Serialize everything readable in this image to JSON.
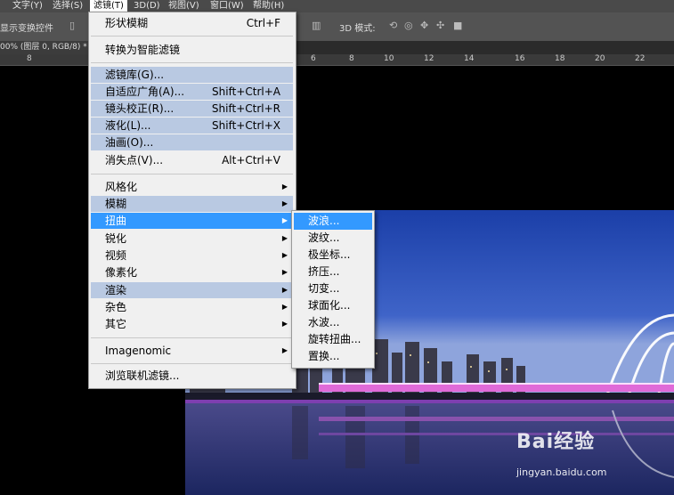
{
  "menubar": {
    "items": [
      {
        "label": "文字(Y)"
      },
      {
        "label": "选择(S)"
      },
      {
        "label": "滤镜(T)"
      },
      {
        "label": "3D(D)"
      },
      {
        "label": "视图(V)"
      },
      {
        "label": "窗口(W)"
      },
      {
        "label": "帮助(H)"
      }
    ]
  },
  "options": {
    "show_transform": "显示变换控件",
    "mode_3d_label": "3D 模式:"
  },
  "document": {
    "tab_title": "00% (图层 0, RGB/8) *"
  },
  "ruler": {
    "left_num": "8",
    "nums": [
      "6",
      "8",
      "10",
      "12",
      "14",
      "16",
      "18",
      "20",
      "22"
    ]
  },
  "filter_menu": {
    "items": [
      {
        "label": "形状模糊",
        "shortcut": "Ctrl+F"
      },
      {
        "label": "转换为智能滤镜",
        "shortcut": ""
      },
      {
        "label": "滤镜库(G)...",
        "shortcut": ""
      },
      {
        "label": "自适应广角(A)...",
        "shortcut": "Shift+Ctrl+A"
      },
      {
        "label": "镜头校正(R)...",
        "shortcut": "Shift+Ctrl+R"
      },
      {
        "label": "液化(L)...",
        "shortcut": "Shift+Ctrl+X"
      },
      {
        "label": "油画(O)...",
        "shortcut": ""
      },
      {
        "label": "消失点(V)...",
        "shortcut": "Alt+Ctrl+V"
      },
      {
        "label": "风格化",
        "shortcut": ""
      },
      {
        "label": "模糊",
        "shortcut": ""
      },
      {
        "label": "扭曲",
        "shortcut": ""
      },
      {
        "label": "锐化",
        "shortcut": ""
      },
      {
        "label": "视频",
        "shortcut": ""
      },
      {
        "label": "像素化",
        "shortcut": ""
      },
      {
        "label": "渲染",
        "shortcut": ""
      },
      {
        "label": "杂色",
        "shortcut": ""
      },
      {
        "label": "其它",
        "shortcut": ""
      },
      {
        "label": "Imagenomic",
        "shortcut": ""
      },
      {
        "label": "浏览联机滤镜...",
        "shortcut": ""
      }
    ]
  },
  "distort_submenu": {
    "items": [
      {
        "label": "波浪..."
      },
      {
        "label": "波纹..."
      },
      {
        "label": "极坐标..."
      },
      {
        "label": "挤压..."
      },
      {
        "label": "切变..."
      },
      {
        "label": "球面化..."
      },
      {
        "label": "水波..."
      },
      {
        "label": "旋转扭曲..."
      },
      {
        "label": "置换..."
      }
    ]
  },
  "watermark": {
    "brand": "Bai经验",
    "url": "jingyan.baidu.com"
  },
  "colors": {
    "menu_bg": "#f0f0f0",
    "selected": "#3399ff",
    "hover_highlight": "#b9c9e2",
    "workspace": "#000000",
    "toolbar": "#535353"
  }
}
